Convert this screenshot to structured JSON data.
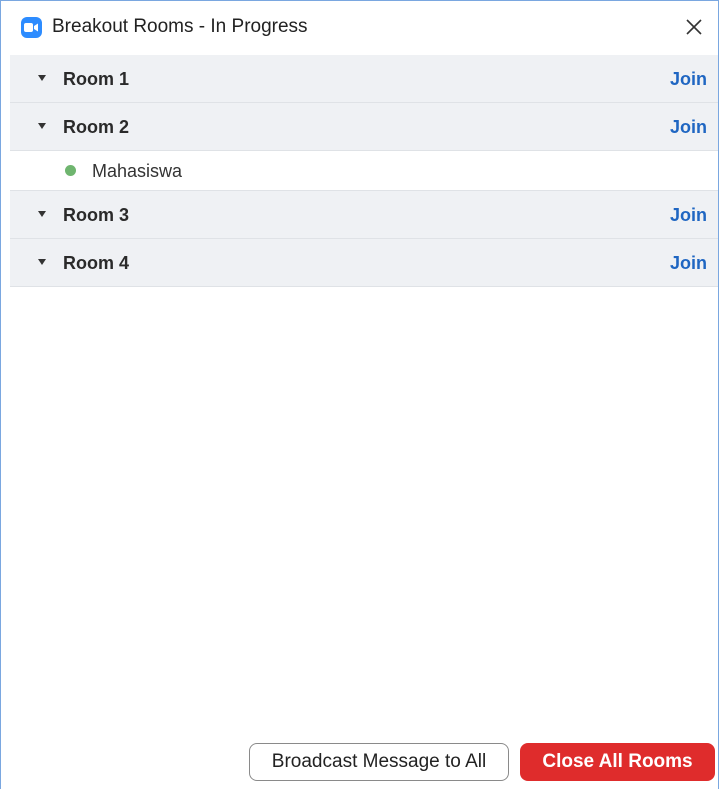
{
  "window": {
    "title": "Breakout Rooms - In Progress",
    "app_icon": "zoom-camera-icon",
    "close_icon": "close-icon"
  },
  "rooms": [
    {
      "name": "Room 1",
      "join_label": "Join",
      "participants": []
    },
    {
      "name": "Room 2",
      "join_label": "Join",
      "participants": [
        {
          "name": "Mahasiswa",
          "status": "online"
        }
      ]
    },
    {
      "name": "Room 3",
      "join_label": "Join",
      "participants": []
    },
    {
      "name": "Room 4",
      "join_label": "Join",
      "participants": []
    }
  ],
  "footer": {
    "broadcast_label": "Broadcast Message to All",
    "close_all_label": "Close All Rooms"
  },
  "colors": {
    "accent_blue": "#1f66c2",
    "zoom_blue": "#2d8cff",
    "danger_red": "#df2c2c",
    "online_green": "#6fb56f",
    "row_background": "#eff1f4"
  }
}
